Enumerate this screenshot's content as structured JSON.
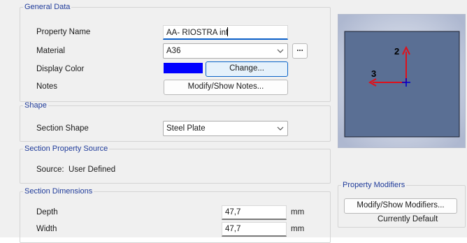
{
  "general": {
    "title": "General Data",
    "property_name_label": "Property Name",
    "property_name_value": "AA- RIOSTRA inf",
    "material_label": "Material",
    "material_value": "A36",
    "material_more_button": "...",
    "display_color_label": "Display Color",
    "display_color_value": "#0000ff",
    "change_button": "Change...",
    "notes_label": "Notes",
    "notes_button": "Modify/Show Notes..."
  },
  "shape": {
    "title": "Shape",
    "section_shape_label": "Section Shape",
    "section_shape_value": "Steel Plate"
  },
  "source": {
    "title": "Section Property Source",
    "text": "Source:  User Defined"
  },
  "dimensions": {
    "title": "Section Dimensions",
    "rows": [
      {
        "label": "Depth",
        "value": "47,7",
        "unit": "mm"
      },
      {
        "label": "Width",
        "value": "47,7",
        "unit": "mm"
      }
    ]
  },
  "preview": {
    "axis2_label": "2",
    "axis3_label": "3",
    "section_fill": "#5a6f94",
    "axis_color": "#e0101a",
    "origin_color": "#0000cc"
  },
  "modifiers": {
    "title": "Property Modifiers",
    "button": "Modify/Show Modifiers...",
    "status": "Currently Default"
  }
}
